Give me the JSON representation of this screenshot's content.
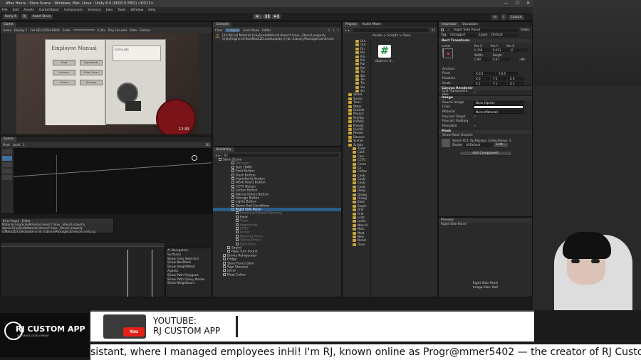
{
  "window": {
    "title": "After Hours - Store Scene - Windows, Mac, Linux - Unity 6.0 (6000.0.58f2) <DX11>",
    "controls": [
      "—",
      "☐",
      "✕"
    ]
  },
  "menu": [
    "File",
    "Edit",
    "Assets",
    "GameObject",
    "Component",
    "Services",
    "Jobs",
    "Tools",
    "Window",
    "Help"
  ],
  "toolbar": {
    "account": "Unity 6",
    "branch": "RJ",
    "asset_store": "Asset Store",
    "layout": "Layout"
  },
  "game_view": {
    "tab": "Game",
    "mode": "Game",
    "display": "Display 1",
    "resolution": "Full HD (1920x1080)",
    "scale_label": "Scale",
    "scale_value": "0.34x",
    "focus": "Play Focused",
    "stats": "Stats",
    "gizmos": "Gizmos",
    "manual": {
      "title": "Employee Manual",
      "page_label": "Full Guide",
      "buttons": [
        "Food",
        "Ingredients",
        "Lockers",
        "Other Rules",
        "Terms",
        "Storage"
      ]
    },
    "clock": "12:30"
  },
  "console": {
    "tab": "Console",
    "buttons": [
      "Clear",
      "Collapse",
      "Error Pause",
      "Editor"
    ],
    "counts": [
      "0",
      "1",
      "0"
    ],
    "message_line1": "[01:08:14] Material GrayScaleMaterial doesn't have _Stencil property",
    "message_line2": "UnityEngine.UI.RectMask2D:LateUpdate () (at ./Library/PackageCache/com"
  },
  "scene_view": {
    "tab": "Scene",
    "pivot": "Pivot",
    "space": "Local",
    "grid": "1",
    "mode": "2D"
  },
  "floating_console": {
    "buttons": [
      "Error Pause",
      "Editor"
    ],
    "line1": "Material GrayScaleMaterial doesn't have _Stencil property",
    "line2": "aterial GrayScaleMaterial doesn't have _Stencil property",
    "line3": "ctMask2D:LateUpdate () (at ./Library/PackageCache/com.unity.ug"
  },
  "ai_nav": {
    "title": "AI Navigation",
    "items": [
      "Surfaces",
      "Show Only Selected",
      "Show NavMesh",
      "Show HeightMesh",
      "Agents",
      "Show Path Polygons",
      "Show Path Query Nodes",
      "Show Neighbours"
    ]
  },
  "hierarchy": {
    "tab": "Hierarchy",
    "search": "All",
    "scene": "Store Scene",
    "items": [
      {
        "label": "Manager",
        "depth": 3,
        "dim": true
      },
      {
        "label": "Text (TMP)",
        "depth": 3
      },
      {
        "label": "Food Button",
        "depth": 3
      },
      {
        "label": "Trash Button",
        "depth": 3
      },
      {
        "label": "Ingredients Button",
        "depth": 3
      },
      {
        "label": "Work Hours Button",
        "depth": 3
      },
      {
        "label": "CCTV Button",
        "depth": 3
      },
      {
        "label": "Locker Button",
        "depth": 3
      },
      {
        "label": "Taking Orders Button",
        "depth": 3
      },
      {
        "label": "Storage Button",
        "depth": 3
      },
      {
        "label": "Lights Button",
        "depth": 3
      },
      {
        "label": "Terms And Conditions",
        "depth": 3
      },
      {
        "label": "Right Side Panel",
        "depth": 3,
        "sel": true
      },
      {
        "label": "Employee Manual Opening",
        "depth": 4,
        "dim": true
      },
      {
        "label": "Food",
        "depth": 4
      },
      {
        "label": "Trash",
        "depth": 4,
        "dim": true
      },
      {
        "label": "Ingredients",
        "depth": 4,
        "dim": true
      },
      {
        "label": "CCTV",
        "depth": 4,
        "dim": true
      },
      {
        "label": "Locker",
        "depth": 4,
        "dim": true
      },
      {
        "label": "Working Hours",
        "depth": 4,
        "dim": true
      },
      {
        "label": "Taking Orders",
        "depth": 4,
        "dim": true
      },
      {
        "label": "Electricity",
        "depth": 4,
        "dim": true
      },
      {
        "label": "Sound",
        "depth": 2
      },
      {
        "label": "Page Turn Sound",
        "depth": 2
      },
      {
        "label": "Drinks Refrigerator",
        "depth": 1
      },
      {
        "label": "Fridge",
        "depth": 1
      },
      {
        "label": "Store Fence Door",
        "depth": 1
      },
      {
        "label": "Sign Steamer",
        "depth": 1
      },
      {
        "label": "Juicer",
        "depth": 1
      },
      {
        "label": "Meat Cutter",
        "depth": 1
      }
    ]
  },
  "project": {
    "tabs": [
      "Project",
      "Audio Mixer"
    ],
    "breadcrumb": "Assets > Scripts > Oven",
    "count": "21",
    "asset_name": "Object in O...",
    "folders": [
      "Out",
      "Out",
      "Fin",
      "Mu",
      "Pla",
      "Pro",
      "Rar",
      "Rer",
      "Tru",
      "Sto",
      "Tex",
      "Tre",
      "Ver",
      "wh",
      "Street",
      "Sunny",
      "Trees",
      "Water",
      "Outside",
      "Physics",
      "PolyTop",
      "Prefabs",
      "Presets",
      "QuickO",
      "Render",
      "Resourc",
      "Scenes",
      "Scripts",
      "Asset",
      "Card",
      "Cars",
      "CCTV",
      "Chara",
      "Cu",
      "Coffee",
      "Cooki",
      "Cooki",
      "Cooki",
      "Cooki",
      "Delay",
      "Dialog",
      "Dialog",
      "Elect",
      "Emplo",
      "Drill",
      "Grill",
      "Load",
      "Locke",
      "Main N",
      "Main",
      "Mast",
      "New",
      "Nickel",
      "Oven"
    ]
  },
  "inspector": {
    "tabs": [
      "Inspector",
      "Occlusion"
    ],
    "name": "Right Side Panel",
    "static": "Static",
    "tag_label": "Tag",
    "tag": "Untagged",
    "layer_label": "Layer",
    "layer": "Default",
    "rect_transform": "Rect Transform",
    "anchor_side": "center",
    "anchor_mid": "middle",
    "pos_headers": [
      "Pos X",
      "Pos Y",
      "Pos Z"
    ],
    "pos": [
      "0.358",
      "0.011",
      "0"
    ],
    "size_headers": [
      "Width",
      "Height"
    ],
    "size": [
      "0.89",
      "0.97"
    ],
    "anchors": "Anchors",
    "pivot_label": "Pivot",
    "pivot": [
      "X 0.5",
      "Y 0.5"
    ],
    "rotation_label": "Rotation",
    "rotation": [
      "X 0",
      "Y 0",
      "Z 0"
    ],
    "scale_label": "Scale",
    "scale": [
      "X 1",
      "Y 1",
      "Z 1"
    ],
    "canvas_renderer": "Canvas Renderer",
    "cull": "Cull Transparent Mes",
    "image": "Image",
    "image_fields": [
      {
        "label": "Source Image",
        "value": "None (Sprite)"
      },
      {
        "label": "Color",
        "value": ""
      },
      {
        "label": "Material",
        "value": "None (Material)"
      },
      {
        "label": "Raycast Target",
        "value": "✓"
      },
      {
        "label": "Raycast Padding",
        "value": ""
      },
      {
        "label": "Maskable",
        "value": "✓"
      }
    ],
    "mask": "Mask",
    "mask_field": "Show Mask Graphic",
    "stencil": "Stencil Id:1, Op:Replace, Comp:Always, V",
    "shader_label": "Shader",
    "shader": "UI/Default",
    "edit": "Edit...",
    "add_component": "Add Component",
    "preview_title": "Preview",
    "preview_name": "Right Side Panel",
    "preview_caption": "Right Side Panel",
    "preview_size": "Image Size: 0x0"
  },
  "banner": {
    "line1": "YOUTUBE:",
    "line2": "RJ CUSTOM APP",
    "logo": "RJ CUSTOM APP",
    "logo_sub": "SOFTWARE DEVELOPMENT"
  },
  "ticker": "sistant, where I managed employees inHi! I'm RJ, known online as Progr@mmer5402 — the creator of RJ Custom"
}
